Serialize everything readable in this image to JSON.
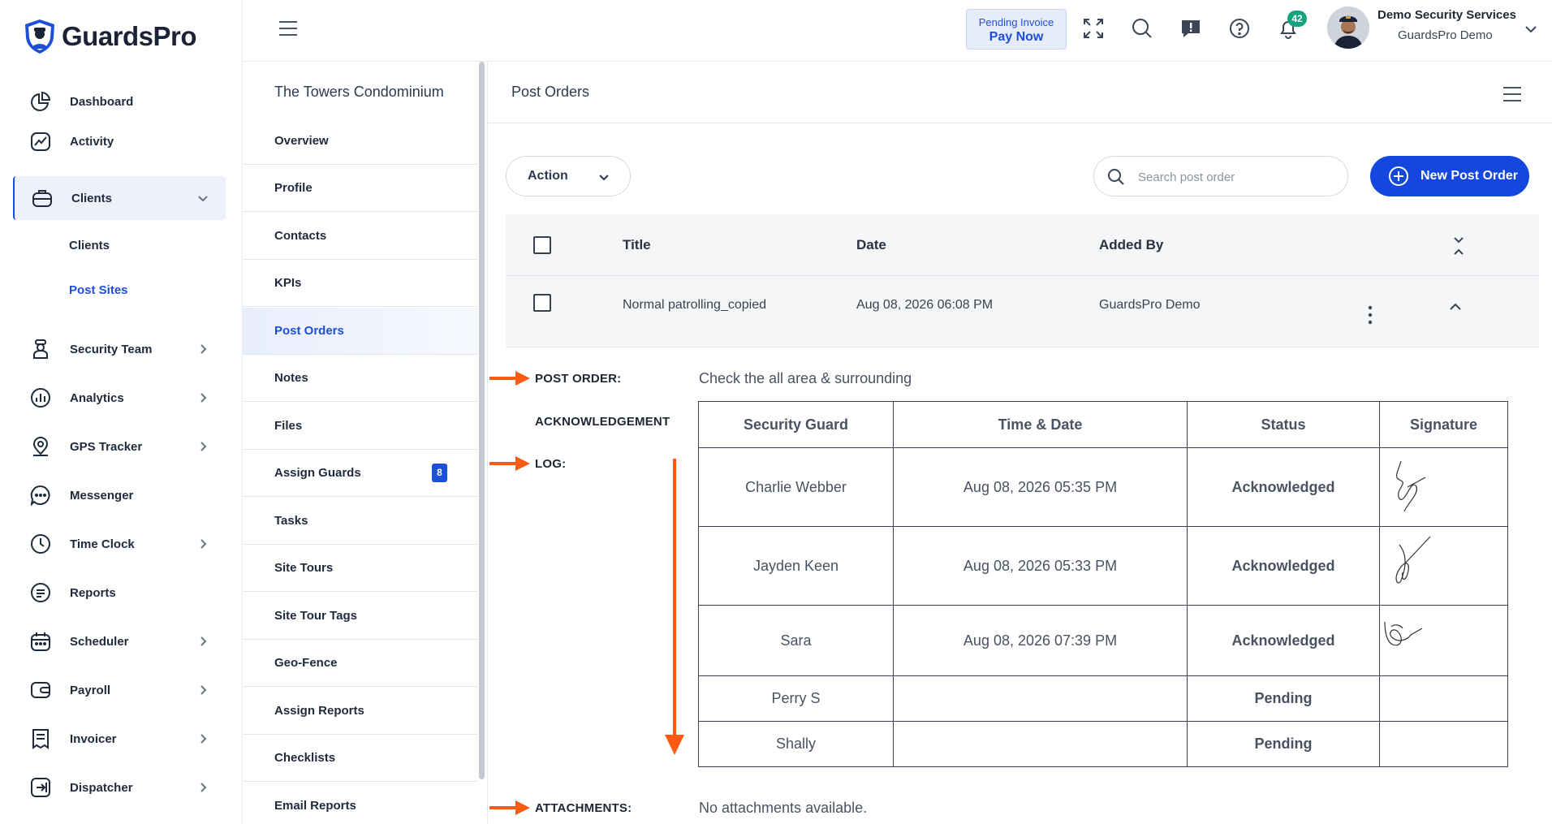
{
  "brand": {
    "name": "GuardsPro"
  },
  "sidebar": {
    "items": [
      {
        "label": "Dashboard",
        "icon": "pie-chart-icon",
        "has_submenu": false
      },
      {
        "label": "Activity",
        "icon": "activity-icon",
        "has_submenu": false
      },
      {
        "label": "Clients",
        "icon": "briefcase-icon",
        "has_submenu": true,
        "expanded": true
      },
      {
        "label": "Security Team",
        "icon": "guard-icon",
        "has_submenu": true
      },
      {
        "label": "Analytics",
        "icon": "analytics-icon",
        "has_submenu": true
      },
      {
        "label": "GPS Tracker",
        "icon": "location-pin-icon",
        "has_submenu": true
      },
      {
        "label": "Messenger",
        "icon": "chat-icon",
        "has_submenu": false
      },
      {
        "label": "Time Clock",
        "icon": "clock-icon",
        "has_submenu": true
      },
      {
        "label": "Reports",
        "icon": "report-icon",
        "has_submenu": false
      },
      {
        "label": "Scheduler",
        "icon": "calendar-icon",
        "has_submenu": true
      },
      {
        "label": "Payroll",
        "icon": "wallet-icon",
        "has_submenu": true
      },
      {
        "label": "Invoicer",
        "icon": "invoice-icon",
        "has_submenu": true
      },
      {
        "label": "Dispatcher",
        "icon": "dispatch-icon",
        "has_submenu": true
      }
    ],
    "clients_sub": [
      {
        "label": "Clients",
        "active": false
      },
      {
        "label": "Post Sites",
        "active": true
      }
    ]
  },
  "header": {
    "pending_invoice": "Pending Invoice",
    "pay_now": "Pay Now",
    "notifications_count": "42",
    "user_company": "Demo Security Services",
    "user_name": "GuardsPro Demo"
  },
  "site_menu": {
    "title": "The Towers Condominium",
    "items": [
      {
        "label": "Overview"
      },
      {
        "label": "Profile"
      },
      {
        "label": "Contacts"
      },
      {
        "label": "KPIs"
      },
      {
        "label": "Post Orders",
        "active": true
      },
      {
        "label": "Notes"
      },
      {
        "label": "Files"
      },
      {
        "label": "Assign Guards",
        "badge": "8"
      },
      {
        "label": "Tasks"
      },
      {
        "label": "Site Tours"
      },
      {
        "label": "Site Tour Tags"
      },
      {
        "label": "Geo-Fence"
      },
      {
        "label": "Assign Reports"
      },
      {
        "label": "Checklists"
      },
      {
        "label": "Email Reports"
      }
    ]
  },
  "main": {
    "title": "Post Orders",
    "action_label": "Action",
    "search_placeholder": "Search post order",
    "new_button": "New Post Order",
    "table": {
      "headers": {
        "title": "Title",
        "date": "Date",
        "added_by": "Added By"
      },
      "rows": [
        {
          "title": "Normal patrolling_copied",
          "date": "Aug 08, 2026 06:08 PM",
          "added_by": "GuardsPro Demo"
        }
      ]
    },
    "details": {
      "post_order_label": "POST ORDER:",
      "post_order_value": "Check the all area & surrounding",
      "ack_label": "ACKNOWLEDGEMENT",
      "log_label": "LOG:",
      "attachments_label": "ATTACHMENTS:",
      "attachments_value": "No attachments available.",
      "ack_headers": [
        "Security Guard",
        "Time & Date",
        "Status",
        "Signature"
      ],
      "ack_rows": [
        {
          "guard": "Charlie Webber",
          "time": "Aug 08, 2026 05:35 PM",
          "status": "Acknowledged",
          "signed": true
        },
        {
          "guard": "Jayden Keen",
          "time": "Aug 08, 2026 05:33 PM",
          "status": "Acknowledged",
          "signed": true
        },
        {
          "guard": "Sara",
          "time": "Aug 08, 2026 07:39 PM",
          "status": "Acknowledged",
          "signed": true
        },
        {
          "guard": "Perry S",
          "time": "",
          "status": "Pending",
          "signed": false
        },
        {
          "guard": "Shally",
          "time": "",
          "status": "Pending",
          "signed": false
        }
      ]
    }
  },
  "colors": {
    "accent": "#1347e0",
    "acknowledged": "#0eae2a",
    "pending": "#e3b007",
    "annotation_arrow": "#ff5a14",
    "notif_badge": "#15a37f"
  }
}
